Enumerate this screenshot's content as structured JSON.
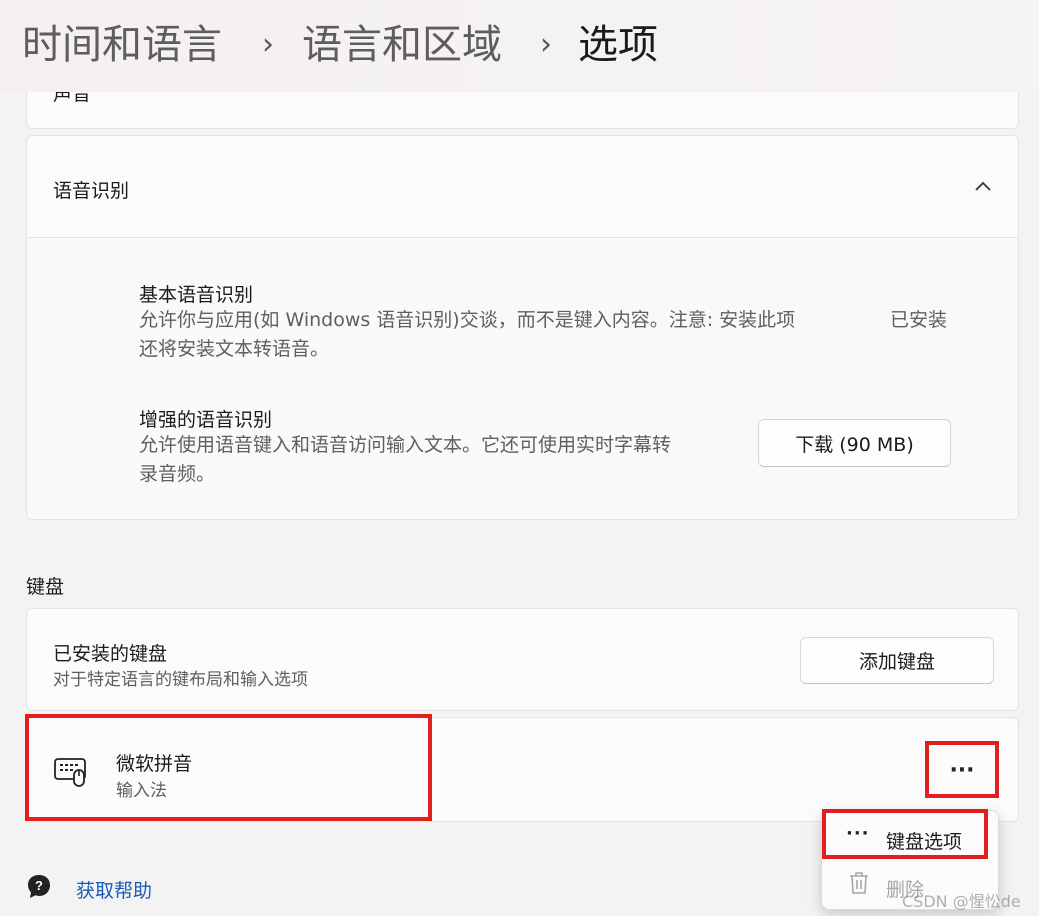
{
  "breadcrumb": {
    "items": [
      "时间和语言",
      "语言和区域",
      "选项"
    ],
    "separator": "›"
  },
  "top_card": {
    "partial_label": "声音"
  },
  "speech": {
    "title": "语音识别",
    "basic": {
      "title": "基本语音识别",
      "desc_line1": "允许你与应用(如 Windows 语音识别)交谈，而不是键入内容。注意: 安装此项",
      "desc_line2": "还将安装文本转语音。",
      "status": "已安装"
    },
    "enhanced": {
      "title": "增强的语音识别",
      "desc_line1": "允许使用语音键入和语音访问输入文本。它还可使用实时字幕转",
      "desc_line2": "录音频。",
      "button": "下载 (90 MB)"
    }
  },
  "keyboard": {
    "section_label": "键盘",
    "installed_title": "已安装的键盘",
    "installed_desc": "对于特定语言的键布局和输入选项",
    "add_button": "添加键盘",
    "item": {
      "name": "微软拼音",
      "type": "输入法",
      "more": "···"
    }
  },
  "context_menu": {
    "items": [
      {
        "label": "键盘选项",
        "icon": "more-icon",
        "enabled": true
      },
      {
        "label": "删除",
        "icon": "trash-icon",
        "enabled": false
      }
    ]
  },
  "help": {
    "label": "获取帮助"
  },
  "watermark": "CSDN @惺忪de",
  "colors": {
    "highlight": "#e01f1f",
    "link": "#1a5bb5"
  }
}
